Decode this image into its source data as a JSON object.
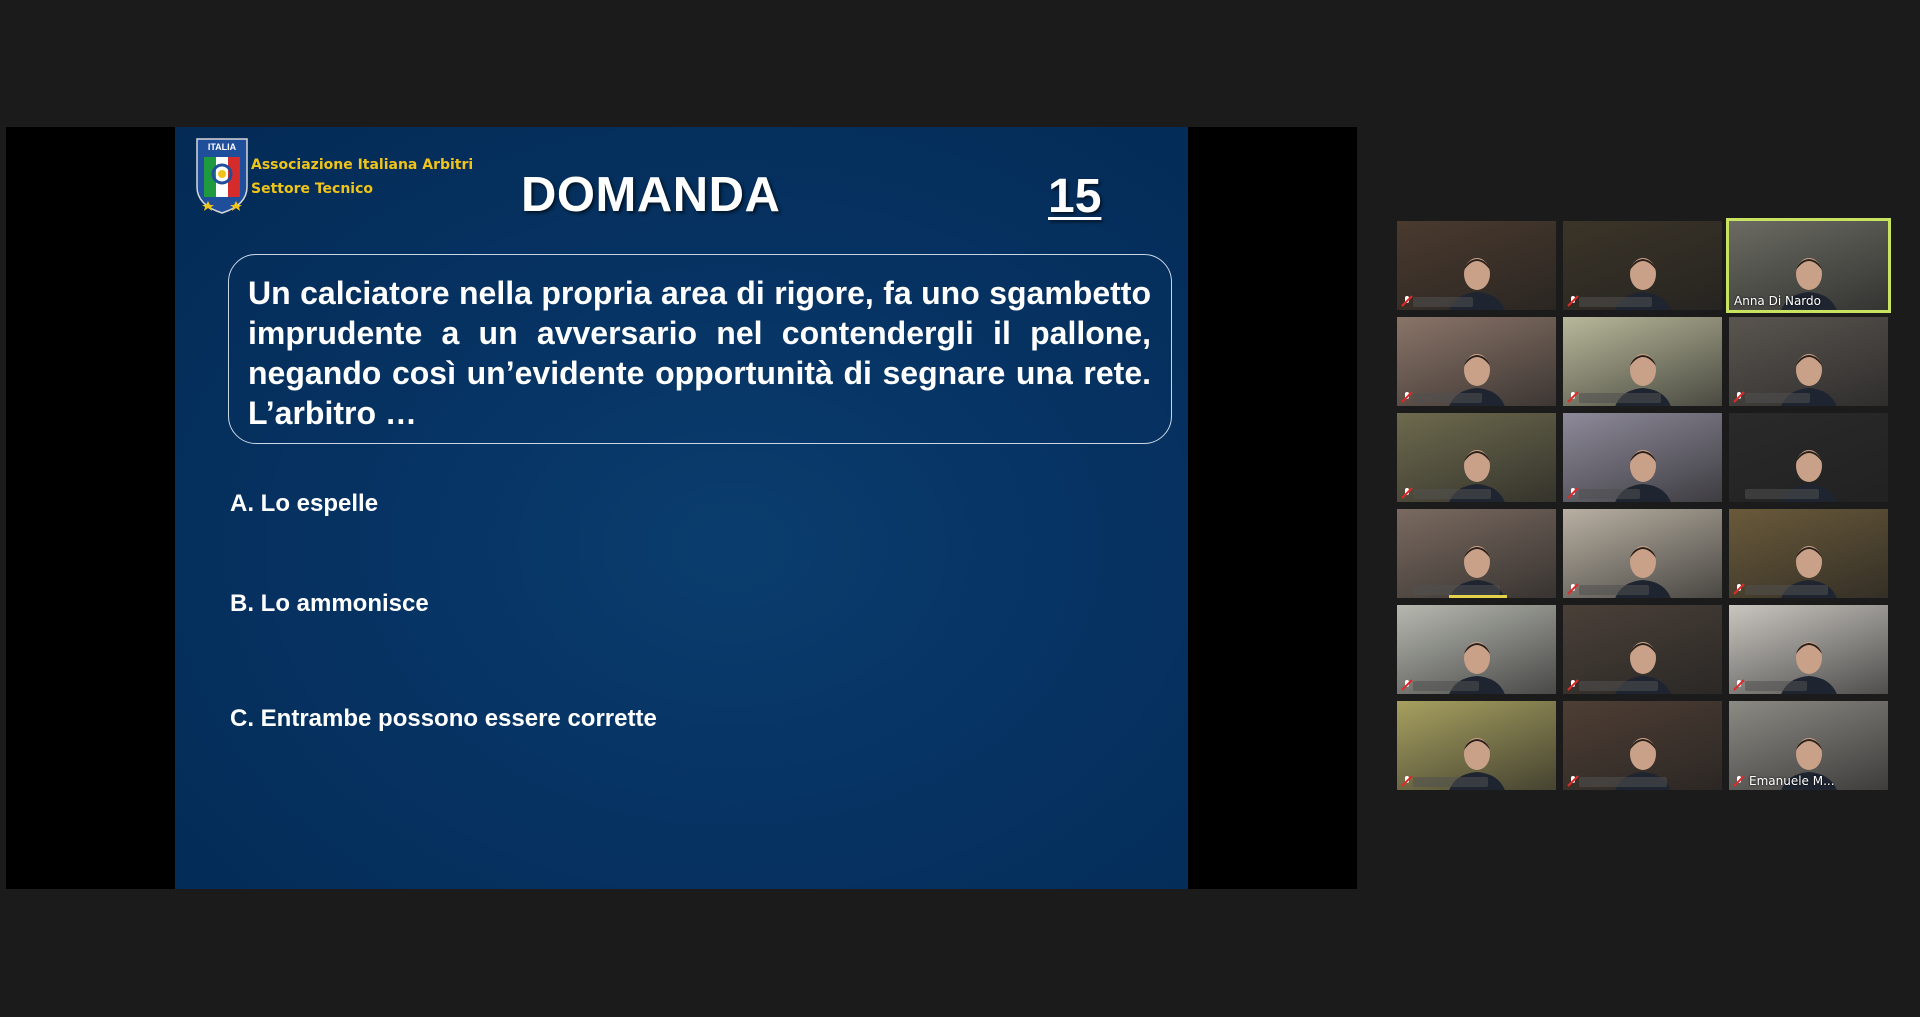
{
  "slide": {
    "logo_text": "ITALIA",
    "association_line1": "Associazione Italiana Arbitri",
    "association_line2": "Settore Tecnico",
    "title": "DOMANDA",
    "question_number": "15",
    "question_text": "Un calciatore nella propria area di rigore, fa uno sgambetto imprudente a un avversario nel contendergli il pallone, negando così un’evidente opportunità di segnare una rete. L’arbitro …",
    "answers": [
      {
        "label": "A. Lo espelle"
      },
      {
        "label": "B. Lo ammonisce"
      },
      {
        "label": "C. Entrambe possono essere corrette"
      }
    ]
  },
  "gallery": {
    "tiles": [
      {
        "name": "",
        "muted": true,
        "active": false,
        "bg": "#4a3a2e"
      },
      {
        "name": "",
        "muted": true,
        "active": false,
        "bg": "#3b3428"
      },
      {
        "name": "Anna Di Nardo",
        "muted": false,
        "active": true,
        "bg": "#6b6b63"
      },
      {
        "name": "",
        "muted": true,
        "active": false,
        "bg": "#8a7468"
      },
      {
        "name": "",
        "muted": true,
        "active": false,
        "bg": "#b8b89a"
      },
      {
        "name": "",
        "muted": true,
        "active": false,
        "bg": "#5a5550"
      },
      {
        "name": "",
        "muted": true,
        "active": false,
        "bg": "#6e6a4e"
      },
      {
        "name": "",
        "muted": true,
        "active": false,
        "bg": "#8e8a9a"
      },
      {
        "name": "",
        "muted": false,
        "active": false,
        "bg": "#2a2a2a"
      },
      {
        "name": "",
        "muted": false,
        "active": false,
        "bg": "#7a6a60",
        "speaking": true
      },
      {
        "name": "",
        "muted": true,
        "active": false,
        "bg": "#b8b0a2"
      },
      {
        "name": "",
        "muted": true,
        "active": false,
        "bg": "#6a5a3a"
      },
      {
        "name": "",
        "muted": true,
        "active": false,
        "bg": "#b6b8b0"
      },
      {
        "name": "",
        "muted": true,
        "active": false,
        "bg": "#4a4038"
      },
      {
        "name": "",
        "muted": true,
        "active": false,
        "bg": "#c9c6c0"
      },
      {
        "name": "",
        "muted": true,
        "active": false,
        "bg": "#a7a060"
      },
      {
        "name": "",
        "muted": true,
        "active": false,
        "bg": "#4e3e34"
      },
      {
        "name": "Emanuele M...",
        "muted": true,
        "active": false,
        "bg": "#8c8a84"
      }
    ]
  },
  "colors": {
    "app_background": "#1b1b1b",
    "slide_background": "#063363",
    "logo_text_color": "#f0c419",
    "active_speaker_border": "#c8e35f",
    "muted_icon": "#e02a2a"
  }
}
